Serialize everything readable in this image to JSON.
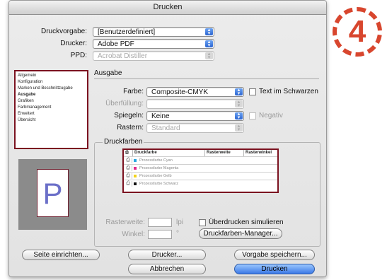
{
  "window": {
    "title": "Drucken"
  },
  "top": {
    "druckvorgabe_label": "Druckvorgabe:",
    "druckvorgabe_value": "[Benutzerdefiniert]",
    "drucker_label": "Drucker:",
    "drucker_value": "Adobe PDF",
    "ppd_label": "PPD:",
    "ppd_value": "Acrobat Distiller"
  },
  "sidebar": {
    "items": [
      {
        "label": "Allgemein"
      },
      {
        "label": "Konfiguration"
      },
      {
        "label": "Marken und Beschnittzugabe"
      },
      {
        "label": "Ausgabe"
      },
      {
        "label": "Grafiken"
      },
      {
        "label": "Farbmanagement"
      },
      {
        "label": "Erweitert"
      },
      {
        "label": "Übersicht"
      }
    ],
    "selected_index": 3
  },
  "ausgabe": {
    "title": "Ausgabe",
    "farbe_label": "Farbe:",
    "farbe_value": "Composite-CMYK",
    "text_schwarz_label": "Text im Schwarzen",
    "ueberfuellung_label": "Überfüllung:",
    "ueberfuellung_value": "",
    "spiegeln_label": "Spiegeln:",
    "spiegeln_value": "Keine",
    "negativ_label": "Negativ",
    "rastern_label": "Rastern:",
    "rastern_value": "Standard"
  },
  "druckfarben": {
    "title": "Druckfarben",
    "columns": [
      "Druckfarbe",
      "Rasterweite",
      "Rasterwinkel"
    ],
    "rows": [
      {
        "name": "Prozessfarbe Cyan",
        "color": "#2aa6e0"
      },
      {
        "name": "Prozessfarbe Magenta",
        "color": "#e0288c"
      },
      {
        "name": "Prozessfarbe Gelb",
        "color": "#f2d21a"
      },
      {
        "name": "Prozessfarbe Schwarz",
        "color": "#111111"
      }
    ],
    "rasterweite_label": "Rasterweite:",
    "rasterweite_unit": "lpi",
    "winkel_label": "Winkel:",
    "winkel_unit": "°",
    "ueberdrucken_label": "Überdrucken simulieren",
    "manager_button": "Druckfarben-Manager..."
  },
  "preview": {
    "letter": "P"
  },
  "buttons": {
    "seite_einrichten": "Seite einrichten...",
    "drucker": "Drucker...",
    "vorgabe_speichern": "Vorgabe speichern...",
    "abbrechen": "Abbrechen",
    "drucken": "Drucken"
  },
  "badge": {
    "number": "4"
  }
}
